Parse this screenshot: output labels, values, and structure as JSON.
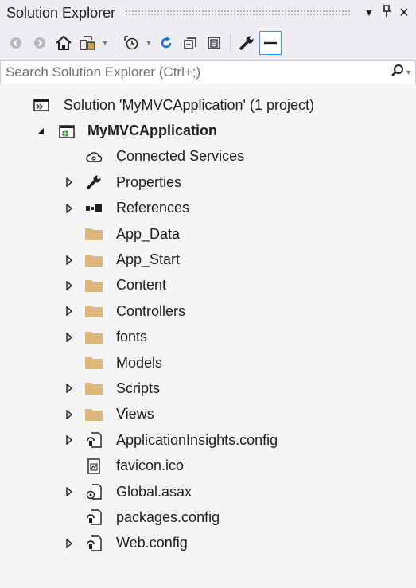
{
  "window": {
    "title": "Solution Explorer",
    "pin_glyph": "↓",
    "dropdown_glyph": "▼",
    "close_glyph": "✕"
  },
  "toolbar": {
    "tools": [
      {
        "name": "back-icon"
      },
      {
        "name": "forward-icon"
      },
      {
        "name": "home-icon"
      },
      {
        "name": "switch-views-icon"
      },
      {
        "name": "pending-changes-filter-icon"
      },
      {
        "name": "sync-icon"
      },
      {
        "name": "collapse-all-icon"
      },
      {
        "name": "show-all-files-icon"
      },
      {
        "name": "properties-wrench-icon"
      },
      {
        "name": "preview-selected-icon"
      }
    ]
  },
  "search": {
    "placeholder": "Search Solution Explorer (Ctrl+;)"
  },
  "tree": {
    "solution": "Solution 'MyMVCApplication' (1 project)",
    "project": "MyMVCApplication",
    "items": [
      {
        "label": "Connected Services",
        "icon": "connected-services-icon",
        "expandable": false
      },
      {
        "label": "Properties",
        "icon": "wrench-icon",
        "expandable": true
      },
      {
        "label": "References",
        "icon": "references-icon",
        "expandable": true
      },
      {
        "label": "App_Data",
        "icon": "folder-icon",
        "expandable": false
      },
      {
        "label": "App_Start",
        "icon": "folder-icon",
        "expandable": true
      },
      {
        "label": "Content",
        "icon": "folder-icon",
        "expandable": true
      },
      {
        "label": "Controllers",
        "icon": "folder-icon",
        "expandable": true
      },
      {
        "label": "fonts",
        "icon": "folder-icon",
        "expandable": true
      },
      {
        "label": "Models",
        "icon": "folder-icon",
        "expandable": false
      },
      {
        "label": "Scripts",
        "icon": "folder-icon",
        "expandable": true
      },
      {
        "label": "Views",
        "icon": "folder-icon",
        "expandable": true
      },
      {
        "label": "ApplicationInsights.config",
        "icon": "config-file-icon",
        "expandable": true
      },
      {
        "label": "favicon.ico",
        "icon": "image-file-icon",
        "expandable": false
      },
      {
        "label": "Global.asax",
        "icon": "asax-file-icon",
        "expandable": true
      },
      {
        "label": "packages.config",
        "icon": "config-file-icon",
        "expandable": false
      },
      {
        "label": "Web.config",
        "icon": "config-file-icon",
        "expandable": true
      }
    ]
  }
}
